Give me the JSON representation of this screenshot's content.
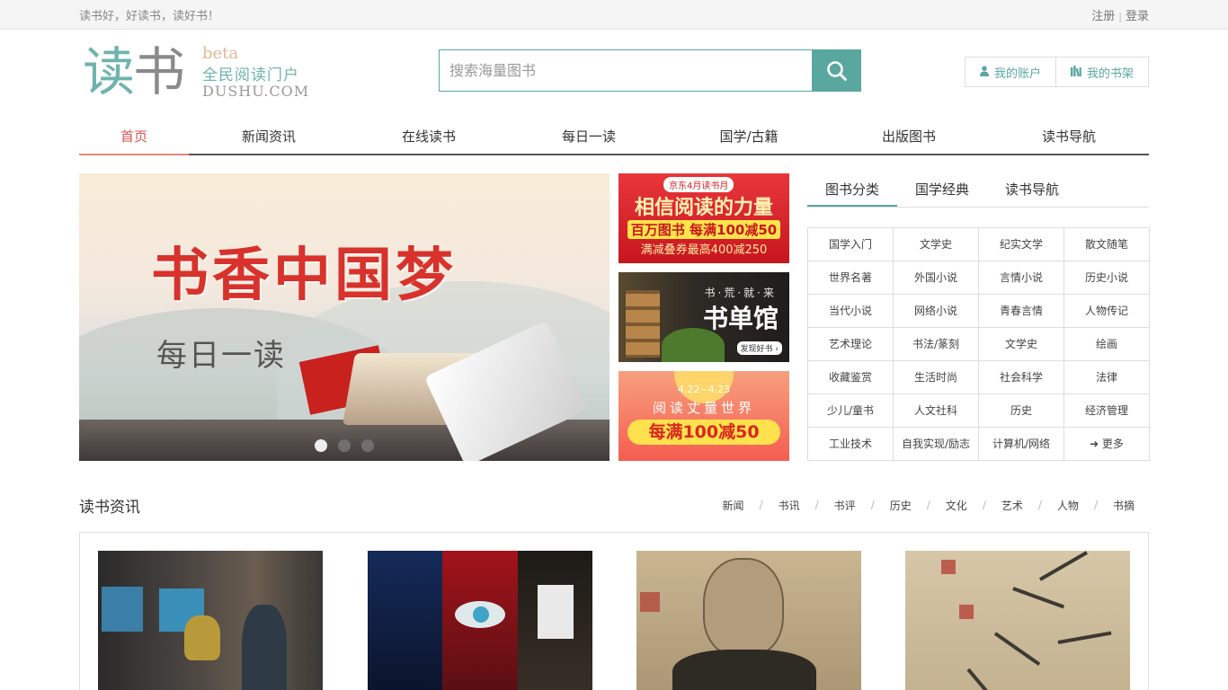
{
  "topbar": {
    "slogan": "读书好，好读书，读好书！",
    "register": "注册",
    "separator": "|",
    "login": "登录"
  },
  "logo": {
    "char1": "读",
    "char2": "书",
    "beta": "beta",
    "slogan": "全民阅读门户",
    "domain": "DUSHU.COM"
  },
  "search": {
    "placeholder": "搜索海量图书",
    "button_icon": "search-icon"
  },
  "account": {
    "my_account": "我的账户",
    "my_account_icon": "user-icon",
    "my_shelf": "我的书架",
    "my_shelf_icon": "bookshelf-icon"
  },
  "nav": {
    "tabs": [
      {
        "label": "首页",
        "active": true
      },
      {
        "label": "新闻资讯"
      },
      {
        "label": "在线读书"
      },
      {
        "label": "每日一读"
      },
      {
        "label": "国学/古籍"
      },
      {
        "label": "出版图书"
      },
      {
        "label": "读书导航"
      }
    ]
  },
  "slider": {
    "title": "书香中国梦",
    "subtitle": "每日一读",
    "dots": 3,
    "active_dot": 0
  },
  "ads": {
    "ad1": {
      "tag": "京东4月读书月",
      "line1": "相信阅读的力量",
      "line2": "百万图书 每满100减50",
      "line3": "满减叠券最高400减250"
    },
    "ad2": {
      "small": "书·荒·就·来",
      "big": "书单馆",
      "pill": "发现好书 ›"
    },
    "ad3": {
      "date": "4.22~4.23",
      "line1": "阅读丈量世界",
      "line2": "每满100减50"
    }
  },
  "categories": {
    "tabs": [
      {
        "label": "图书分类",
        "active": true
      },
      {
        "label": "国学经典"
      },
      {
        "label": "读书导航"
      }
    ],
    "cells": [
      "国学入门",
      "文学史",
      "纪实文学",
      "散文随笔",
      "世界名著",
      "外国小说",
      "言情小说",
      "历史小说",
      "当代小说",
      "网络小说",
      "青春言情",
      "人物传记",
      "艺术理论",
      "书法/篆刻",
      "文学史",
      "绘画",
      "收藏鉴赏",
      "生活时尚",
      "社会科学",
      "法律",
      "少儿/童书",
      "人文社科",
      "历史",
      "经济管理",
      "工业技术",
      "自我实现/励志",
      "计算机/网络",
      "➜ 更多"
    ]
  },
  "news": {
    "heading": "读书资讯",
    "links": [
      "新闻",
      "书讯",
      "书评",
      "历史",
      "文化",
      "艺术",
      "人物",
      "书摘"
    ],
    "link_separator": "/"
  },
  "colors": {
    "accent": "#5aa7a0",
    "nav_active": "#d9534f",
    "topbar_bg": "#f5f5f5"
  }
}
